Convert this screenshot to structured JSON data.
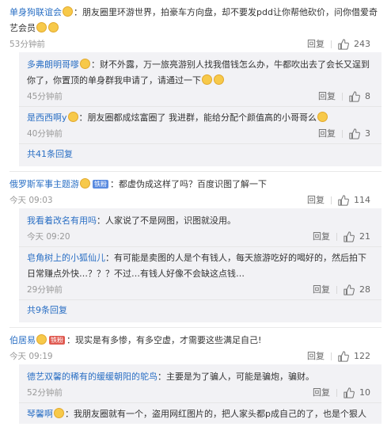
{
  "comments": [
    {
      "user": "单身狗联谊会",
      "text": "：朋友圈里环游世界，拍豪车方向盘，却不要发pdd让你帮他砍价，问你借爱奇艺会员",
      "time": "53分钟前",
      "reply": "回复",
      "likes": "243",
      "replies": [
        {
          "user": "多弗朗明哥嗲",
          "text": "：财不外露，万一旅亮游别人找我借钱怎么办，牛都吹出去了会长又逞到你了，你置顶的单身群我申请了，请通过一下",
          "time": "45分钟前",
          "reply": "回复",
          "likes": "8"
        },
        {
          "user": "是西西啊y",
          "text": "：朋友圈都成炫富圈了 我进群，能给分配个颜值高的小哥哥么",
          "time": "40分钟前",
          "reply": "回复",
          "likes": "3"
        }
      ],
      "more": "共41条回复"
    },
    {
      "user": "俄罗斯军事主题游",
      "badge": "铁粉",
      "text": "：都虚伪成这样了吗？百度识图了解一下",
      "time": "今天 09:03",
      "reply": "回复",
      "likes": "114",
      "replies": [
        {
          "user": "我看着改名有用吗",
          "text": "：人家说了不是网图，识图就没用。",
          "time": "今天 09:20",
          "reply": "回复",
          "likes": "21"
        },
        {
          "user": "皂角树上的小狐仙儿",
          "text": "：有可能是卖图的人是个有钱人，每天旅游吃好的喝好的，然后拍下日常赚点外快…？？？不过…有钱人好像不会缺这点钱…",
          "time": "29分钟前",
          "reply": "回复",
          "likes": "28"
        }
      ],
      "more": "共9条回复"
    },
    {
      "user": "伯居易",
      "badge": "铁粉",
      "text": "：现实是有多惨，有多空虚，才需要这些满足自己!",
      "time": "今天 09:19",
      "reply": "回复",
      "likes": "122",
      "replies": [
        {
          "user": "德艺双馨的稀有的缓缓朝阳的鸵鸟",
          "text": "：主要是为了骗人，可能是骗炮，骗财。",
          "time": "52分钟前",
          "reply": "回复",
          "likes": "10"
        },
        {
          "user": "琴馨啊",
          "text": "：我朋友圈就有一个，盗用网红图片的，把人家头都p成自己的了，也是个狠人",
          "time": "",
          "reply": "",
          "likes": ""
        }
      ]
    }
  ],
  "colors": {
    "link": "#2a6fc4",
    "reply_bg": "#f2f2f5",
    "meta": "#999999"
  },
  "icons": {
    "like": "thumb-up-icon",
    "emoji": "smiley-emoji-icon"
  }
}
